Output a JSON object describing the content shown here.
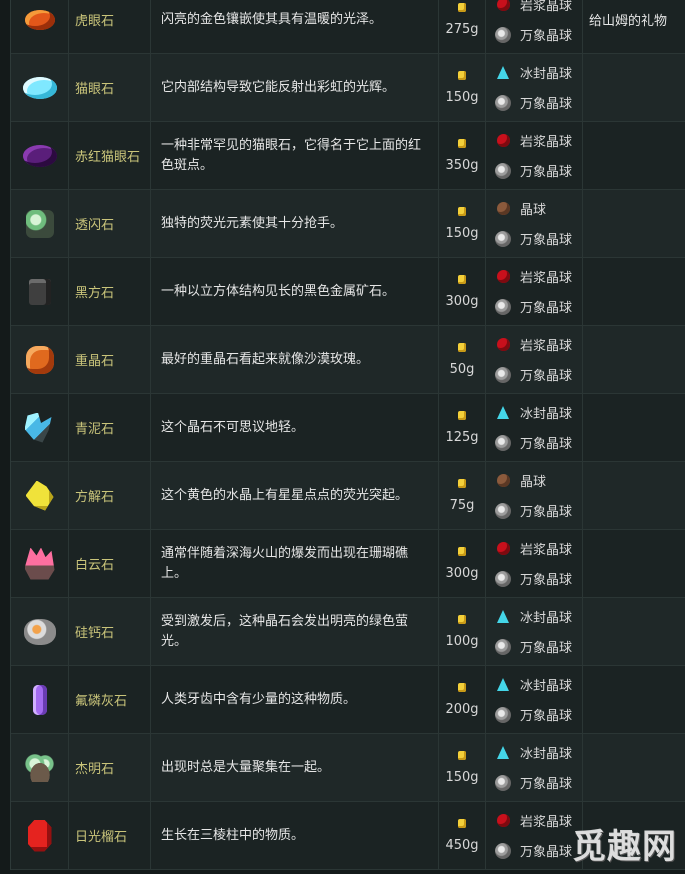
{
  "rows": [
    {
      "name": "虎眼石",
      "desc": "闪亮的金色镶嵌使其具有温暖的光泽。",
      "price": "275g",
      "gem_icon": "tiger-eye-gem",
      "orbs": [
        "岩浆晶球",
        "万象晶球"
      ],
      "note": "给山姆的礼物"
    },
    {
      "name": "猫眼石",
      "desc": "它内部结构导致它能反射出彩虹的光辉。",
      "price": "150g",
      "gem_icon": "opal-gem",
      "orbs": [
        "冰封晶球",
        "万象晶球"
      ],
      "note": ""
    },
    {
      "name": "赤红猫眼石",
      "desc": "一种非常罕见的猫眼石，它得名于它上面的红色斑点。",
      "price": "350g",
      "gem_icon": "fire-opal-gem",
      "orbs": [
        "岩浆晶球",
        "万象晶球"
      ],
      "note": ""
    },
    {
      "name": "透闪石",
      "desc": "独特的荧光元素使其十分抢手。",
      "price": "150g",
      "gem_icon": "tremolite-gem",
      "orbs": [
        "晶球",
        "万象晶球"
      ],
      "note": ""
    },
    {
      "name": "黑方石",
      "desc": "一种以立方体结构见长的黑色金属矿石。",
      "price": "300g",
      "gem_icon": "nekoite-gem",
      "orbs": [
        "岩浆晶球",
        "万象晶球"
      ],
      "note": ""
    },
    {
      "name": "重晶石",
      "desc": "最好的重晶石看起来就像沙漠玫瑰。",
      "price": "50g",
      "gem_icon": "baryte-gem",
      "orbs": [
        "岩浆晶球",
        "万象晶球"
      ],
      "note": ""
    },
    {
      "name": "青泥石",
      "desc": "这个晶石不可思议地轻。",
      "price": "125g",
      "gem_icon": "celestine-gem",
      "orbs": [
        "冰封晶球",
        "万象晶球"
      ],
      "note": ""
    },
    {
      "name": "方解石",
      "desc": "这个黄色的水晶上有星星点点的荧光突起。",
      "price": "75g",
      "gem_icon": "calcite-gem",
      "orbs": [
        "晶球",
        "万象晶球"
      ],
      "note": ""
    },
    {
      "name": "白云石",
      "desc": "通常伴随着深海火山的爆发而出现在珊瑚礁上。",
      "price": "300g",
      "gem_icon": "dolomite-gem",
      "orbs": [
        "岩浆晶球",
        "万象晶球"
      ],
      "note": ""
    },
    {
      "name": "硅钙石",
      "desc": "受到激发后，这种晶石会发出明亮的绿色萤光。",
      "price": "100g",
      "gem_icon": "esperite-gem",
      "orbs": [
        "冰封晶球",
        "万象晶球"
      ],
      "note": ""
    },
    {
      "name": "氟磷灰石",
      "desc": "人类牙齿中含有少量的这种物质。",
      "price": "200g",
      "gem_icon": "fluorapatite-gem",
      "orbs": [
        "冰封晶球",
        "万象晶球"
      ],
      "note": ""
    },
    {
      "name": "杰明石",
      "desc": "出现时总是大量聚集在一起。",
      "price": "150g",
      "gem_icon": "geminite-gem",
      "orbs": [
        "冰封晶球",
        "万象晶球"
      ],
      "note": ""
    },
    {
      "name": "日光榴石",
      "desc": "生长在三棱柱中的物质。",
      "price": "450g",
      "gem_icon": "helvite-gem",
      "orbs": [
        "岩浆晶球",
        "万象晶球"
      ],
      "note": ""
    }
  ],
  "watermark": "觅趣网",
  "colors": {
    "name_text": "#c9c47a",
    "coin": "#f4d03a",
    "magma": "#c8101c",
    "frozen": "#44d6e8"
  }
}
